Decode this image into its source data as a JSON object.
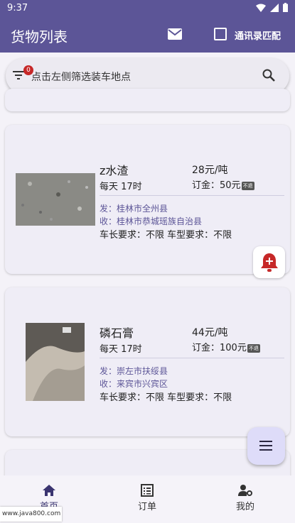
{
  "status": {
    "time": "9:37"
  },
  "appbar": {
    "title": "货物列表",
    "contacts_match_label": "通讯录匹配",
    "contacts_match_checked": false
  },
  "search": {
    "placeholder": "点击左侧筛选装车地点",
    "filter_count": "0"
  },
  "cargo": [
    {
      "name": "z水渣",
      "time": "每天 17时",
      "price": "28元/吨",
      "deposit_label": "订金：",
      "deposit": "50元",
      "refund_tag": "不退",
      "from": "发：桂林市全州县",
      "to": "收：桂林市恭城瑶族自治县",
      "requirements": "车长要求：不限 车型要求：不限",
      "image_color": "#8a8a85"
    },
    {
      "name": "磷石膏",
      "time": "每天 17时",
      "price": "44元/吨",
      "deposit_label": "订金：",
      "deposit": "100元",
      "refund_tag": "不退",
      "from": "发：崇左市扶绥县",
      "to": "收：来宾市兴宾区",
      "requirements": "车长要求：不限 车型要求：不限",
      "image_color": "#b0a89e"
    }
  ],
  "nav": {
    "home": "首页",
    "orders": "订单",
    "mine": "我的"
  },
  "watermark": "www.java800.com",
  "colors": {
    "primary": "#5c5597",
    "badge": "#c62828",
    "alert": "#c62828"
  }
}
